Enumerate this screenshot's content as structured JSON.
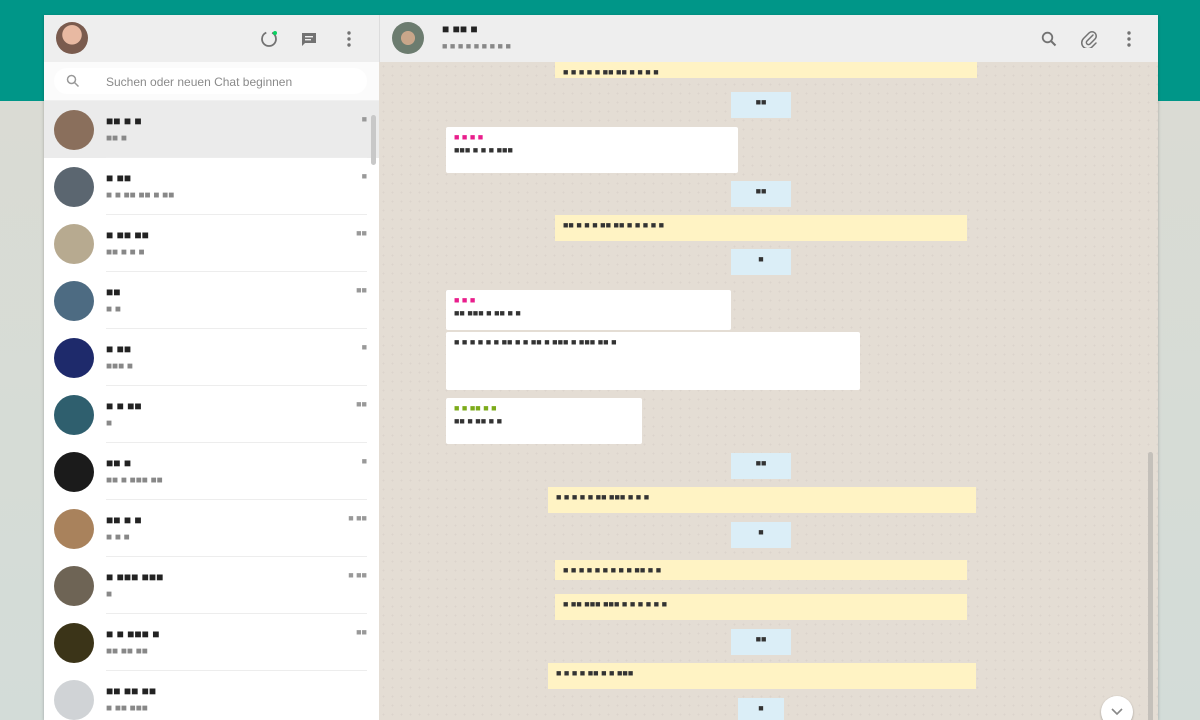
{
  "search": {
    "placeholder": "Suchen oder neuen Chat beginnen"
  },
  "chats": [
    {
      "name": "■■ ■ ■",
      "preview": "■■ ■",
      "time": "■",
      "avatar_color": "#8a6f5c"
    },
    {
      "name": "■ ■■",
      "preview": "■ ■ ■■ ■■ ■ ■■",
      "time": "■",
      "avatar_color": "#5b6670"
    },
    {
      "name": "■ ■■ ■■",
      "preview": "■■ ■ ■ ■",
      "time": "■■",
      "avatar_color": "#b7aa90"
    },
    {
      "name": "■■",
      "preview": "■ ■",
      "time": "■■",
      "avatar_color": "#4d6b82"
    },
    {
      "name": "■ ■■",
      "preview": "■■■ ■",
      "time": "■",
      "avatar_color": "#1e2a6b"
    },
    {
      "name": "■ ■ ■■",
      "preview": "■",
      "time": "■■",
      "avatar_color": "#2f5f6e"
    },
    {
      "name": "■■ ■",
      "preview": "■■ ■ ■■■ ■■",
      "time": "■",
      "avatar_color": "#1b1b1b"
    },
    {
      "name": "■■ ■ ■",
      "preview": "■ ■ ■",
      "time": "■ ■■",
      "avatar_color": "#a9825c"
    },
    {
      "name": "■ ■■■ ■■■",
      "preview": "■",
      "time": "■ ■■",
      "avatar_color": "#6e6455"
    },
    {
      "name": "■ ■ ■■■ ■",
      "preview": "■■ ■■ ■■",
      "time": "■■",
      "avatar_color": "#3b3418"
    },
    {
      "name": "■■ ■■ ■■",
      "preview": "■ ■■ ■■■",
      "time": "",
      "avatar_color": "#d0d3d6"
    }
  ],
  "conversation": {
    "name": "■ ■■ ■",
    "status": "■ ■ ■ ■ ■ ■ ■ ■ ■"
  },
  "messages": {
    "sys1": "■ ■ ■ ■ ■ ■■ ■■ ■ ■ ■ ■",
    "date1": "■■",
    "msg1_sender": "■ ■ ■ ■",
    "msg1_text": "■■■ ■ ■ ■ ■■■",
    "date2": "■■",
    "sys2": "■■ ■ ■ ■ ■■ ■■ ■ ■ ■ ■ ■",
    "date3": "■",
    "msg2_sender": "■ ■ ■",
    "msg2_text": "■■ ■■■ ■ ■■ ■ ■",
    "msg3_text": "■ ■ ■ ■ ■ ■ ■■ ■ ■ ■■ ■ ■■■ ■ ■■■ ■■ ■",
    "msg4_sender": "■ ■ ■■ ■ ■",
    "msg4_text": "■■ ■ ■■ ■ ■",
    "date4": "■■",
    "sys3": "■ ■ ■ ■ ■ ■■ ■■■ ■ ■ ■",
    "date5": "■",
    "sys4": "■ ■ ■ ■ ■ ■ ■ ■ ■ ■■ ■ ■",
    "sys5": "■ ■■ ■■■ ■■■ ■ ■ ■ ■ ■ ■",
    "date6": "■■",
    "sys6": "■ ■ ■ ■ ■■ ■ ■ ■■■",
    "date7": "■"
  }
}
